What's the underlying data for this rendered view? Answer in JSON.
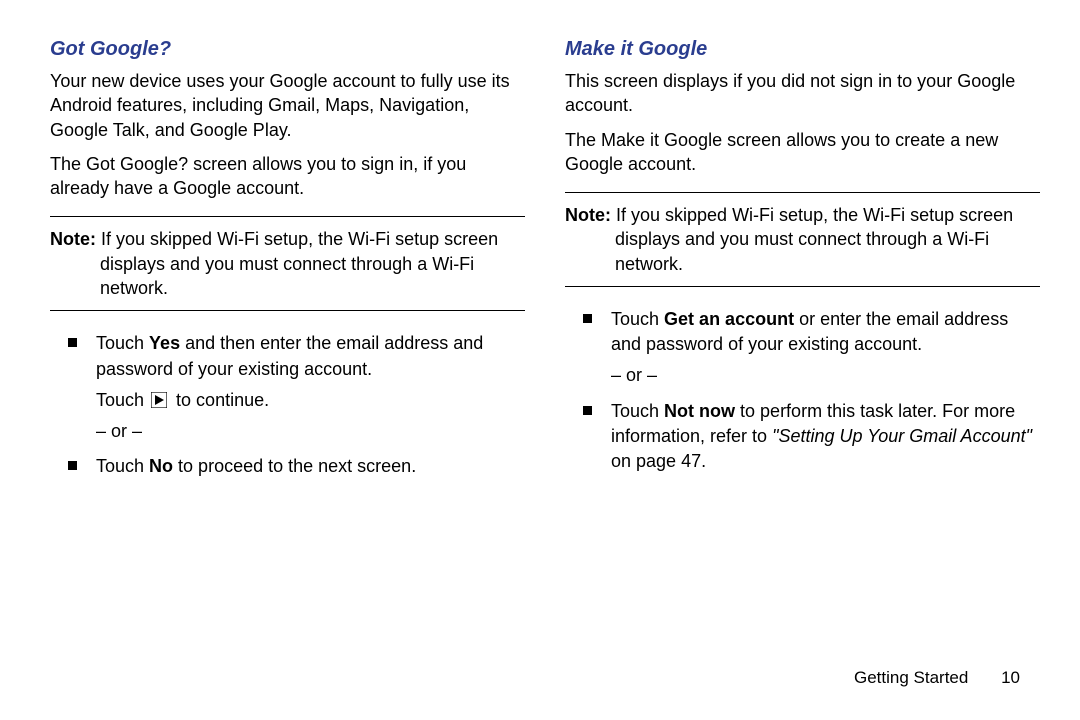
{
  "left": {
    "heading": "Got Google?",
    "p1": "Your new device uses your Google account to fully use its Android features, including Gmail, Maps, Navigation, Google Talk, and Google Play.",
    "p2": "The Got Google? screen allows you to sign in, if you already have a Google account.",
    "note_label": "Note:",
    "note_body": " If you skipped Wi-Fi setup, the Wi-Fi setup screen displays and you must connect through a Wi-Fi network.",
    "b1_pre": "Touch ",
    "b1_bold": "Yes",
    "b1_post": " and then enter the email address and password of your existing account.",
    "b1_sub1a": "Touch ",
    "b1_sub1b": " to continue.",
    "b1_sub2": "– or –",
    "b2_pre": "Touch ",
    "b2_bold": "No",
    "b2_post": " to proceed to the next screen."
  },
  "right": {
    "heading": "Make it Google",
    "p1": "This screen displays if you did not sign in to your Google account.",
    "p2": "The Make it Google screen allows you to create a new Google account.",
    "note_label": "Note:",
    "note_body": " If you skipped Wi-Fi setup, the Wi-Fi setup screen displays and you must connect through a Wi-Fi network.",
    "b1_pre": "Touch ",
    "b1_bold": "Get an account",
    "b1_post": " or enter the email address and password of your existing account.",
    "b1_sub1": "– or –",
    "b2_pre": "Touch ",
    "b2_bold": "Not now",
    "b2_mid": " to perform this task later. For more information, refer to ",
    "b2_ref": "\"Setting Up Your Gmail Account\"",
    "b2_post": " on page 47."
  },
  "footer": {
    "section": "Getting Started",
    "page": "10"
  }
}
